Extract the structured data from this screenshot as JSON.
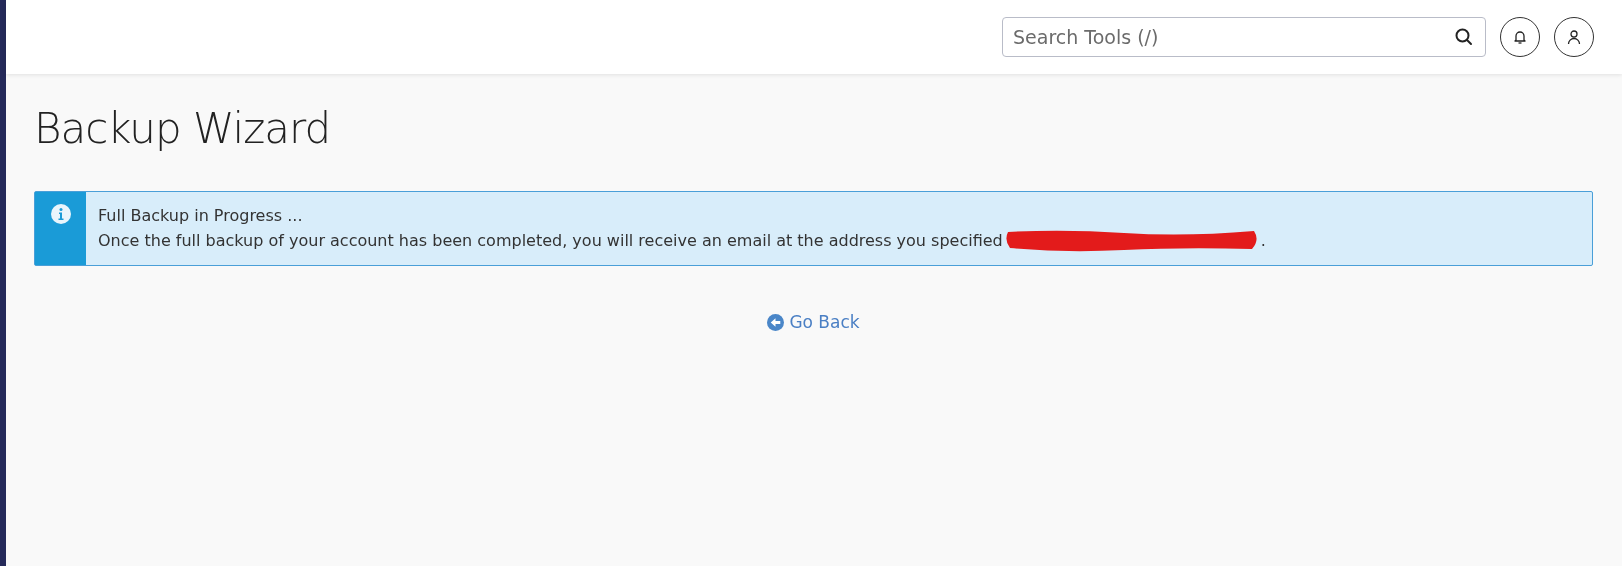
{
  "header": {
    "search": {
      "placeholder": "Search Tools (/)"
    }
  },
  "page": {
    "title": "Backup Wizard"
  },
  "alert": {
    "kind": "info",
    "title": "Full Backup in Progress ...",
    "message": "Once the full backup of your account has been completed, you will receive an email at the address you specified",
    "redacted": true,
    "end": "."
  },
  "link": {
    "label": "Go Back"
  }
}
